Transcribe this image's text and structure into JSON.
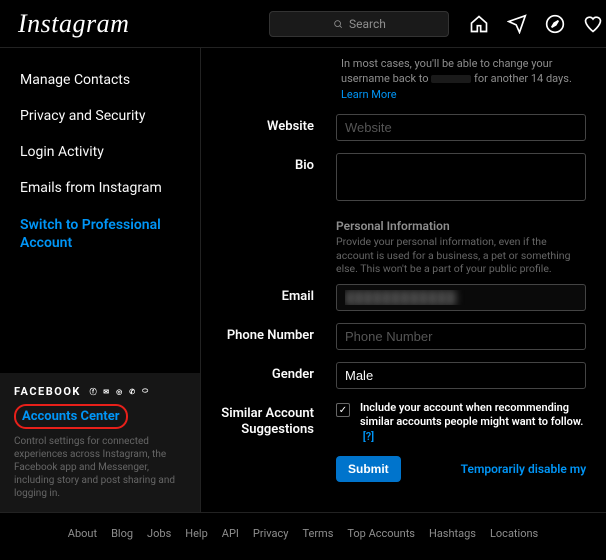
{
  "header": {
    "logo": "Instagram",
    "search_placeholder": "Search"
  },
  "sidebar": {
    "items": [
      {
        "label": "Manage Contacts"
      },
      {
        "label": "Privacy and Security"
      },
      {
        "label": "Login Activity"
      },
      {
        "label": "Emails from Instagram"
      },
      {
        "label": "Switch to Professional Account"
      }
    ],
    "fb": {
      "title": "FACEBOOK",
      "accounts_center": "Accounts Center",
      "desc": "Control settings for connected experiences across Instagram, the Facebook app and Messenger, including story and post sharing and logging in."
    }
  },
  "content": {
    "username_note_pre": "In most cases, you'll be able to change your username back to",
    "username_note_post": "for another 14 days.",
    "learn_more": "Learn More",
    "labels": {
      "website": "Website",
      "bio": "Bio",
      "email": "Email",
      "phone": "Phone Number",
      "gender": "Gender",
      "similar": "Similar Account Suggestions"
    },
    "placeholders": {
      "website": "Website",
      "phone": "Phone Number"
    },
    "values": {
      "gender": "Male",
      "email_hidden": "████████████"
    },
    "personal_info": {
      "title": "Personal Information",
      "desc": "Provide your personal information, even if the account is used for a business, a pet or something else. This won't be a part of your public profile."
    },
    "similar_text": "Include your account when recommending similar accounts people might want to follow.",
    "similar_help": "[?]",
    "submit": "Submit",
    "disable": "Temporarily disable my"
  },
  "footer": {
    "links": [
      "About",
      "Blog",
      "Jobs",
      "Help",
      "API",
      "Privacy",
      "Terms",
      "Top Accounts",
      "Hashtags",
      "Locations"
    ]
  }
}
